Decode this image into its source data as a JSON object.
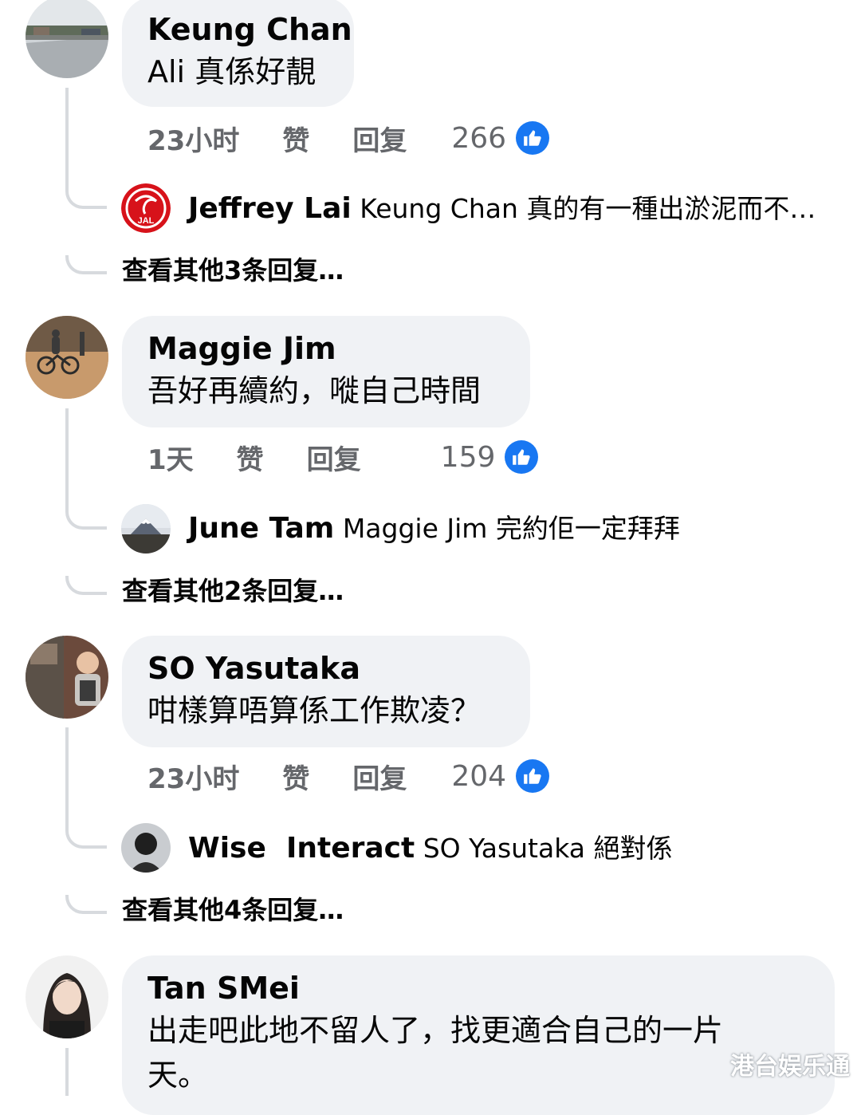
{
  "comments": [
    {
      "author": "Keung Chan",
      "text": "Ali 真係好靚",
      "time": "23小时",
      "like_label": "赞",
      "reply_label": "回复",
      "like_count": "266",
      "reply_preview": {
        "author": "Jeffrey Lai",
        "text": "Keung Chan 真的有一種出淤泥而不…"
      },
      "more_replies": "查看其他3条回复…"
    },
    {
      "author": "Maggie Jim",
      "text": "吾好再續約，嘥自己時間",
      "time": "1天",
      "like_label": "赞",
      "reply_label": "回复",
      "like_count": "159",
      "reply_preview": {
        "author": "June Tam",
        "text": "Maggie Jim 完約佢一定拜拜"
      },
      "more_replies": "查看其他2条回复…"
    },
    {
      "author": "SO Yasutaka",
      "text": "咁樣算唔算係工作欺凌？",
      "time": "23小时",
      "like_label": "赞",
      "reply_label": "回复",
      "like_count": "204",
      "reply_preview": {
        "author": "Wise  Interact",
        "text": "SO Yasutaka 絕對係"
      },
      "more_replies": "查看其他4条回复…"
    },
    {
      "author": "Tan SMei",
      "text_line1": "出走吧此地不留人了，找更適合自己的一片",
      "text_line2": "天。"
    }
  ],
  "icons": {
    "like": "thumbs-up-icon",
    "avatar_brand": "jal-logo"
  },
  "colors": {
    "bubble": "#f0f2f5",
    "meta_text": "#65676b",
    "like_blue": "#1877f2",
    "thread_line": "#d7dade",
    "jal_red": "#d7121a"
  },
  "jal_text": "JAL",
  "watermark": "港台娱乐通"
}
